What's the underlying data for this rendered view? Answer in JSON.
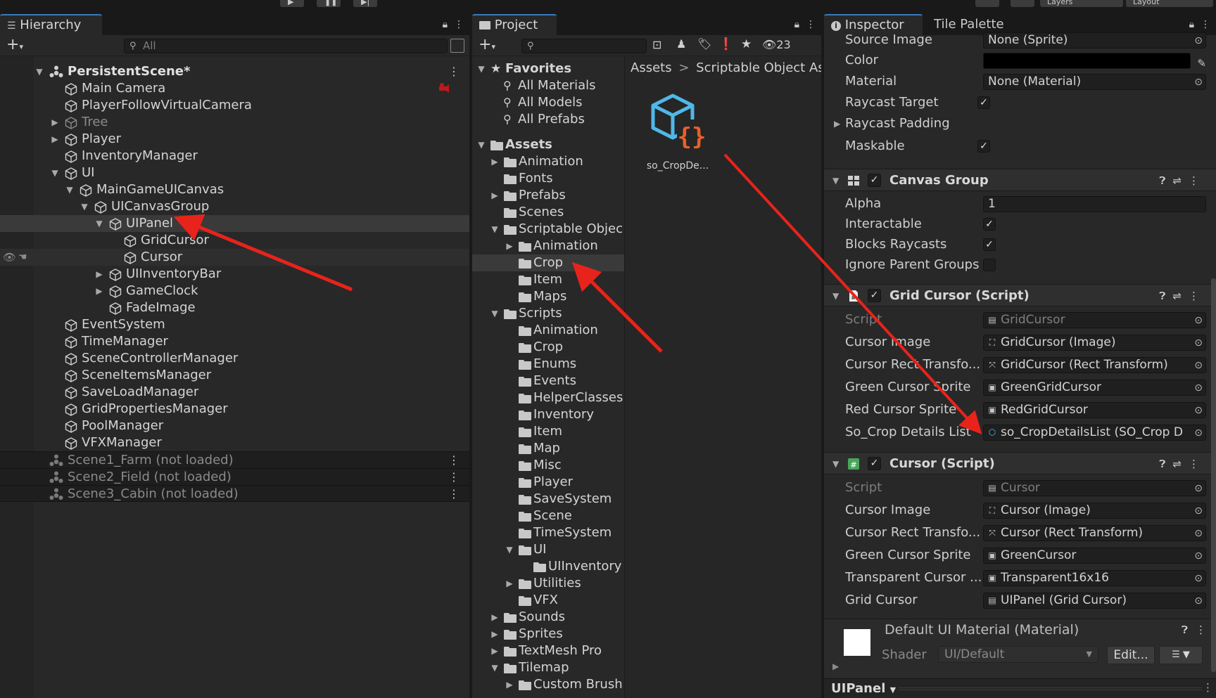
{
  "hierarchy": {
    "tab_label": "Hierarchy",
    "search_placeholder": "All",
    "scene_name": "PersistentScene*",
    "items": [
      {
        "label": "Main Camera"
      },
      {
        "label": "PlayerFollowVirtualCamera"
      },
      {
        "label": "Tree"
      },
      {
        "label": "Player"
      },
      {
        "label": "InventoryManager"
      },
      {
        "label": "UI"
      },
      {
        "label": "MainGameUICanvas"
      },
      {
        "label": "UICanvasGroup"
      },
      {
        "label": "UIPanel"
      },
      {
        "label": "GridCursor"
      },
      {
        "label": "Cursor"
      },
      {
        "label": "UIInventoryBar"
      },
      {
        "label": "GameClock"
      },
      {
        "label": "FadeImage"
      },
      {
        "label": "EventSystem"
      },
      {
        "label": "TimeManager"
      },
      {
        "label": "SceneControllerManager"
      },
      {
        "label": "SceneItemsManager"
      },
      {
        "label": "SaveLoadManager"
      },
      {
        "label": "GridPropertiesManager"
      },
      {
        "label": "PoolManager"
      },
      {
        "label": "VFXManager"
      }
    ],
    "unloaded_scenes": [
      "Scene1_Farm (not loaded)",
      "Scene2_Field (not loaded)",
      "Scene3_Cabin (not loaded)"
    ]
  },
  "project": {
    "tab_label": "Project",
    "hidden_count": "23",
    "favorites_label": "Favorites",
    "favorites": [
      "All Materials",
      "All Models",
      "All Prefabs"
    ],
    "assets_label": "Assets",
    "tree": [
      {
        "label": "Animation"
      },
      {
        "label": "Fonts"
      },
      {
        "label": "Prefabs"
      },
      {
        "label": "Scenes"
      },
      {
        "label": "Scriptable Objec"
      },
      {
        "label": "Animation"
      },
      {
        "label": "Crop"
      },
      {
        "label": "Item"
      },
      {
        "label": "Maps"
      },
      {
        "label": "Scripts"
      },
      {
        "label": "Animation"
      },
      {
        "label": "Crop"
      },
      {
        "label": "Enums"
      },
      {
        "label": "Events"
      },
      {
        "label": "HelperClasses"
      },
      {
        "label": "Inventory"
      },
      {
        "label": "Item"
      },
      {
        "label": "Map"
      },
      {
        "label": "Misc"
      },
      {
        "label": "Player"
      },
      {
        "label": "SaveSystem"
      },
      {
        "label": "Scene"
      },
      {
        "label": "TimeSystem"
      },
      {
        "label": "UI"
      },
      {
        "label": "UIInventory"
      },
      {
        "label": "Utilities"
      },
      {
        "label": "VFX"
      },
      {
        "label": "Sounds"
      },
      {
        "label": "Sprites"
      },
      {
        "label": "TextMesh Pro"
      },
      {
        "label": "Tilemap"
      },
      {
        "label": "Custom Brush"
      }
    ],
    "breadcrumb": {
      "root": "Assets",
      "separator": ">",
      "current": "Scriptable Object Asse"
    },
    "asset_name": "so_CropDe..."
  },
  "inspector": {
    "tab_label": "Inspector",
    "tab2_label": "Tile Palette",
    "image_props": [
      {
        "label": "Source Image",
        "value": "None (Sprite)"
      },
      {
        "label": "Color",
        "value": ""
      },
      {
        "label": "Material",
        "value": "None (Material)"
      },
      {
        "label": "Raycast Target",
        "check": "✓"
      },
      {
        "label": "Raycast Padding"
      },
      {
        "label": "Maskable",
        "check": "✓"
      }
    ],
    "canvas_group": {
      "title": "Canvas Group",
      "props": [
        {
          "label": "Alpha",
          "value": "1"
        },
        {
          "label": "Interactable",
          "check": "✓"
        },
        {
          "label": "Blocks Raycasts",
          "check": "✓"
        },
        {
          "label": "Ignore Parent Groups",
          "check": ""
        }
      ]
    },
    "grid_cursor": {
      "title": "Grid Cursor (Script)",
      "props": [
        {
          "label": "Script",
          "value": "GridCursor"
        },
        {
          "label": "Cursor Image",
          "value": "GridCursor (Image)"
        },
        {
          "label": "Cursor Rect Transfo...",
          "value": "GridCursor (Rect Transform)"
        },
        {
          "label": "Green Cursor Sprite",
          "value": "GreenGridCursor"
        },
        {
          "label": "Red Cursor Sprite",
          "value": "RedGridCursor"
        },
        {
          "label": "So_Crop Details List",
          "value": "so_CropDetailsList (SO_Crop D"
        }
      ]
    },
    "cursor": {
      "title": "Cursor (Script)",
      "props": [
        {
          "label": "Script",
          "value": "Cursor"
        },
        {
          "label": "Cursor Image",
          "value": "Cursor (Image)"
        },
        {
          "label": "Cursor Rect Transfo...",
          "value": "Cursor (Rect Transform)"
        },
        {
          "label": "Green Cursor Sprite",
          "value": "GreenCursor"
        },
        {
          "label": "Transparent Cursor ...",
          "value": "Transparent16x16"
        },
        {
          "label": "Grid Cursor",
          "value": "UIPanel (Grid Cursor)"
        }
      ]
    },
    "material": {
      "title": "Default UI Material (Material)",
      "shader_label": "Shader",
      "shader_value": "UI/Default",
      "edit_label": "Edit..."
    },
    "footer_label": "UIPanel"
  },
  "toolbar": {
    "layers_label": "Layers",
    "layout_label": "Layout"
  },
  "colors": {
    "arrow": "#e8231b",
    "selection": "#3a3a3a",
    "accent": "#3a79bb",
    "asset_blue": "#4fb8e8",
    "asset_orange": "#e8602c"
  }
}
